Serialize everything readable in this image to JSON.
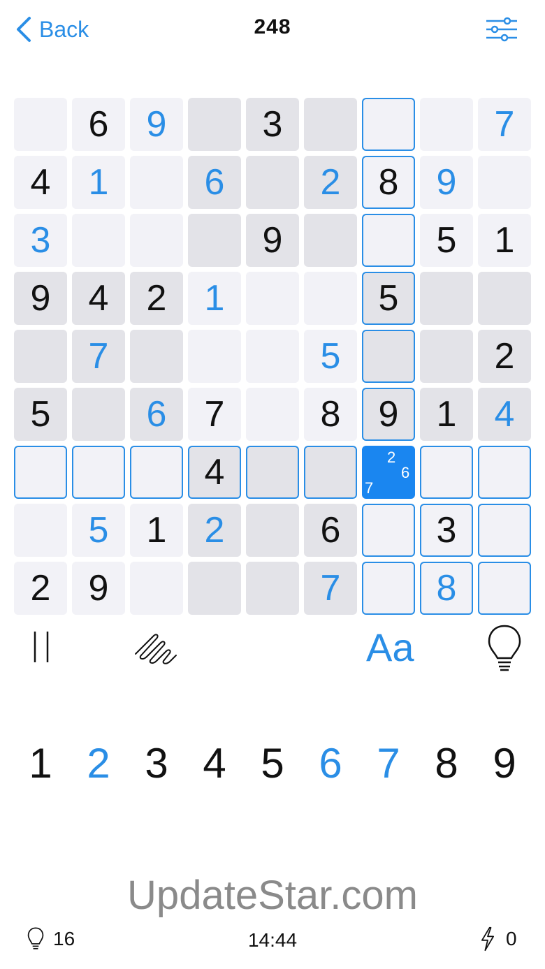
{
  "header": {
    "back_label": "Back",
    "title": "248"
  },
  "colors": {
    "accent": "#2a8ee6",
    "selected": "#1a86f0",
    "cell_light": "#f2f2f7",
    "cell_dark": "#e3e3e8"
  },
  "board": {
    "selected": [
      6,
      6
    ],
    "selected_notes": [
      "2",
      "6",
      "7"
    ],
    "values": [
      [
        "",
        "6",
        "9",
        "",
        "3",
        "",
        "",
        "",
        "7"
      ],
      [
        "4",
        "1",
        "",
        "6",
        "",
        "2",
        "8",
        "9",
        ""
      ],
      [
        "3",
        "",
        "",
        "",
        "9",
        "",
        "",
        "5",
        "1"
      ],
      [
        "9",
        "4",
        "2",
        "1",
        "",
        "",
        "5",
        "",
        ""
      ],
      [
        "",
        "7",
        "",
        "",
        "",
        "5",
        "",
        "",
        "2"
      ],
      [
        "5",
        "",
        "6",
        "7",
        "",
        "8",
        "9",
        "1",
        "4"
      ],
      [
        "",
        "",
        "",
        "4",
        "",
        "",
        "",
        "",
        ""
      ],
      [
        "",
        "5",
        "1",
        "2",
        "",
        "6",
        "",
        "3",
        ""
      ],
      [
        "2",
        "9",
        "",
        "",
        "",
        "7",
        "",
        "8",
        ""
      ]
    ],
    "user_entered": [
      [
        false,
        false,
        true,
        false,
        false,
        false,
        false,
        false,
        true
      ],
      [
        false,
        true,
        false,
        true,
        false,
        true,
        false,
        true,
        false
      ],
      [
        true,
        false,
        false,
        false,
        false,
        false,
        false,
        false,
        false
      ],
      [
        false,
        false,
        false,
        true,
        false,
        false,
        false,
        false,
        false
      ],
      [
        false,
        true,
        false,
        false,
        false,
        true,
        false,
        false,
        false
      ],
      [
        false,
        false,
        true,
        false,
        false,
        false,
        false,
        false,
        true
      ],
      [
        false,
        false,
        false,
        false,
        false,
        false,
        false,
        false,
        false
      ],
      [
        false,
        true,
        false,
        true,
        false,
        false,
        false,
        false,
        false
      ],
      [
        false,
        false,
        false,
        false,
        false,
        true,
        false,
        true,
        false
      ]
    ]
  },
  "toolbar": {
    "pause_icon": "pause-icon",
    "pencil_icon": "scribble-icon",
    "font_label": "Aa",
    "hint_icon": "lightbulb-icon"
  },
  "numpad": [
    {
      "label": "1",
      "highlight": false
    },
    {
      "label": "2",
      "highlight": true
    },
    {
      "label": "3",
      "highlight": false
    },
    {
      "label": "4",
      "highlight": false
    },
    {
      "label": "5",
      "highlight": false
    },
    {
      "label": "6",
      "highlight": true
    },
    {
      "label": "7",
      "highlight": true
    },
    {
      "label": "8",
      "highlight": false
    },
    {
      "label": "9",
      "highlight": false
    }
  ],
  "watermark": "UpdateStar.com",
  "status": {
    "hints_count": "16",
    "timer": "14:44",
    "streak_count": "0"
  }
}
